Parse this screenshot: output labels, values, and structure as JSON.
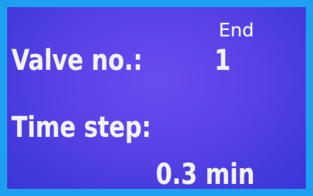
{
  "display": {
    "end_label": "End",
    "valve_label": "Valve no.:",
    "valve_value": "1",
    "time_step_label": "Time step:",
    "time_step_value": "0.3 min"
  }
}
